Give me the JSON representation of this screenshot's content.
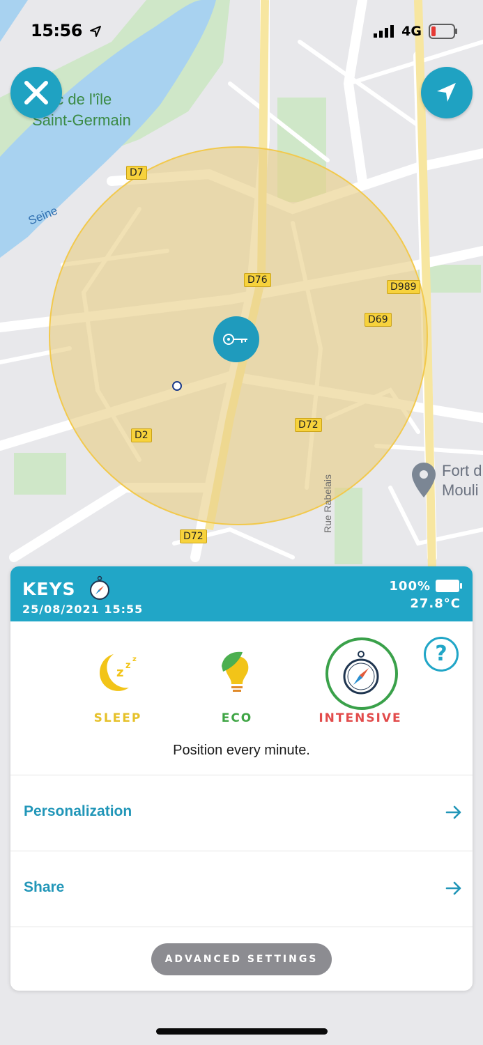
{
  "status_bar": {
    "time": "15:56",
    "network": "4G",
    "location_icon": "location-arrow-icon",
    "battery_icon": "battery-low-icon"
  },
  "map": {
    "labels": {
      "park": "Parc de l'île\nSaint-Germain",
      "river_top": "Seine",
      "river_left": "Seine",
      "fort": "Fort d\nMouli",
      "street": "Rue Rabelais"
    },
    "roads": {
      "d7": "D7",
      "d76": "D76",
      "d989": "D989",
      "d69": "D69",
      "d2": "D2",
      "d72a": "D72",
      "d72b": "D72"
    },
    "geofence_color": "#f2c94c",
    "marker_icon": "key-icon",
    "close_icon": "close-icon",
    "navigate_icon": "navigation-arrow-icon"
  },
  "panel": {
    "device_name": "KEYS",
    "device_icon": "compass-icon",
    "timestamp": "25/08/2021 15:55",
    "battery": "100%",
    "temperature": "27.8°C",
    "help_icon": "help-icon",
    "modes": [
      {
        "label": "SLEEP",
        "color": "#e6c12a",
        "icon": "moon-zzz-icon"
      },
      {
        "label": "ECO",
        "color": "#3fa545",
        "icon": "leaf-bulb-icon"
      },
      {
        "label": "INTENSIVE",
        "color": "#e24b4b",
        "icon": "compass-icon",
        "selected": true
      }
    ],
    "mode_description": "Position every minute.",
    "rows": [
      {
        "label": "Personalization",
        "icon": "arrow-right-icon"
      },
      {
        "label": "Share",
        "icon": "arrow-right-icon"
      }
    ],
    "advanced_button": "ADVANCED SETTINGS",
    "accent": "#21a6c7"
  }
}
